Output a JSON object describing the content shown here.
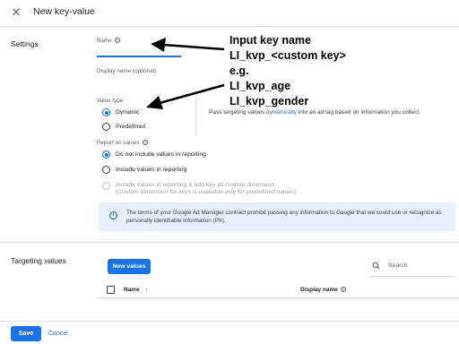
{
  "header": {
    "close_icon": "close-icon",
    "title": "New key-value"
  },
  "settings": {
    "section_label": "Settings",
    "name_label": "Name",
    "display_name_label": "Display name (optional)",
    "value_type_label": "Value type",
    "value_type_options": [
      "Dynamic",
      "Predefined"
    ],
    "value_type_selected": "Dynamic",
    "hint_prefix": "Pass targeting values ",
    "hint_link": "dynamically",
    "hint_suffix": " into an ad tag based on information you collect.",
    "report_label": "Report on values",
    "report_options": [
      "Do not include values in reporting",
      "Include values in reporting",
      "Include values in reporting & add key as custom dimension",
      "(Custom dimension for keys is available only for predefined values)"
    ],
    "report_selected": "Do not include values in reporting",
    "info_text": "The terms of your Google Ad Manager contract prohibit passing any information to Google that we could use or recognize as personally identifiable information (PII)."
  },
  "annotation": {
    "lines": [
      "Input key name",
      "LI_kvp_<custom key>",
      "e.g.",
      "LI_kvp_age",
      "LI_kvp_gender"
    ]
  },
  "targeting": {
    "section_label": "Targeting values",
    "new_values_label": "New values",
    "search_placeholder": "Search",
    "columns": [
      "Name",
      "Display name"
    ]
  },
  "footer": {
    "save_label": "Save",
    "cancel_label": "Cancel"
  },
  "colors": {
    "accent": "#1a73e8",
    "info_bg": "#e8f0fe"
  }
}
